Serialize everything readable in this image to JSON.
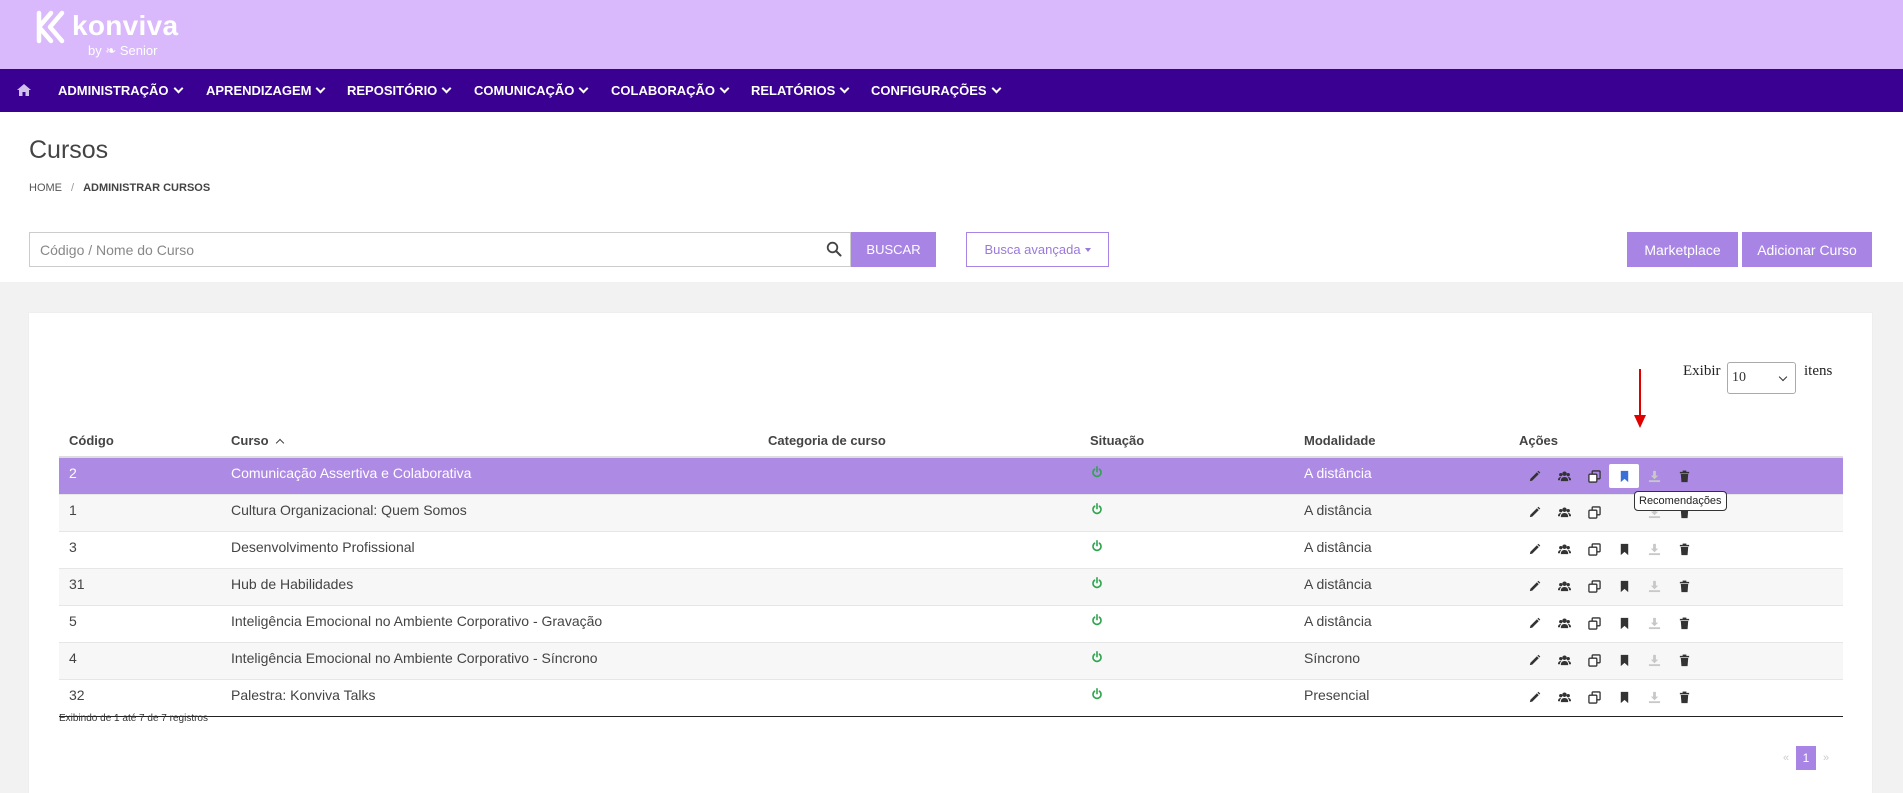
{
  "brand": {
    "name": "konviva",
    "sub": "by ❧ Senior"
  },
  "nav": {
    "items": [
      {
        "label": "ADMINISTRAÇÃO"
      },
      {
        "label": "APRENDIZAGEM"
      },
      {
        "label": "REPOSITÓRIO"
      },
      {
        "label": "COMUNICAÇÃO"
      },
      {
        "label": "COLABORAÇÃO"
      },
      {
        "label": "RELATÓRIOS"
      },
      {
        "label": "CONFIGURAÇÕES"
      }
    ]
  },
  "page": {
    "title": "Cursos",
    "breadcrumb": {
      "home": "HOME",
      "sep": "/",
      "current": "ADMINISTRAR CURSOS"
    }
  },
  "search": {
    "placeholder": "Código / Nome do Curso",
    "button": "BUSCAR",
    "advanced": "Busca avançada"
  },
  "toolbar": {
    "marketplace": "Marketplace",
    "add": "Adicionar Curso"
  },
  "paging": {
    "show": "Exibir",
    "size": "10",
    "items": "itens"
  },
  "table": {
    "headers": {
      "codigo": "Código",
      "curso": "Curso",
      "categoria": "Categoria de curso",
      "situacao": "Situação",
      "modalidade": "Modalidade",
      "acoes": "Ações"
    },
    "rows": [
      {
        "codigo": "2",
        "curso": "Comunicação Assertiva e Colaborativa",
        "categoria": "",
        "modalidade": "A distância"
      },
      {
        "codigo": "1",
        "curso": "Cultura Organizacional: Quem Somos",
        "categoria": "",
        "modalidade": "A distância"
      },
      {
        "codigo": "3",
        "curso": "Desenvolvimento Profissional",
        "categoria": "",
        "modalidade": "A distância"
      },
      {
        "codigo": "31",
        "curso": "Hub de Habilidades",
        "categoria": "",
        "modalidade": "A distância"
      },
      {
        "codigo": "5",
        "curso": "Inteligência Emocional no Ambiente Corporativo - Gravação",
        "categoria": "",
        "modalidade": "A distância"
      },
      {
        "codigo": "4",
        "curso": "Inteligência Emocional no Ambiente Corporativo - Síncrono",
        "categoria": "",
        "modalidade": "Síncrono"
      },
      {
        "codigo": "32",
        "curso": "Palestra: Konviva Talks",
        "categoria": "",
        "modalidade": "Presencial"
      }
    ]
  },
  "tooltip": "Recomendações",
  "footer": {
    "info": "Exibindo de 1 até 7 de 7 registros",
    "first": "«",
    "page": "1",
    "last": "»"
  },
  "colors": {
    "brand_bar": "#d9b8fb",
    "nav_bar": "#3a0092",
    "accent": "#a884e5",
    "status_active": "#2ea44f",
    "arrow": "#e00000"
  }
}
